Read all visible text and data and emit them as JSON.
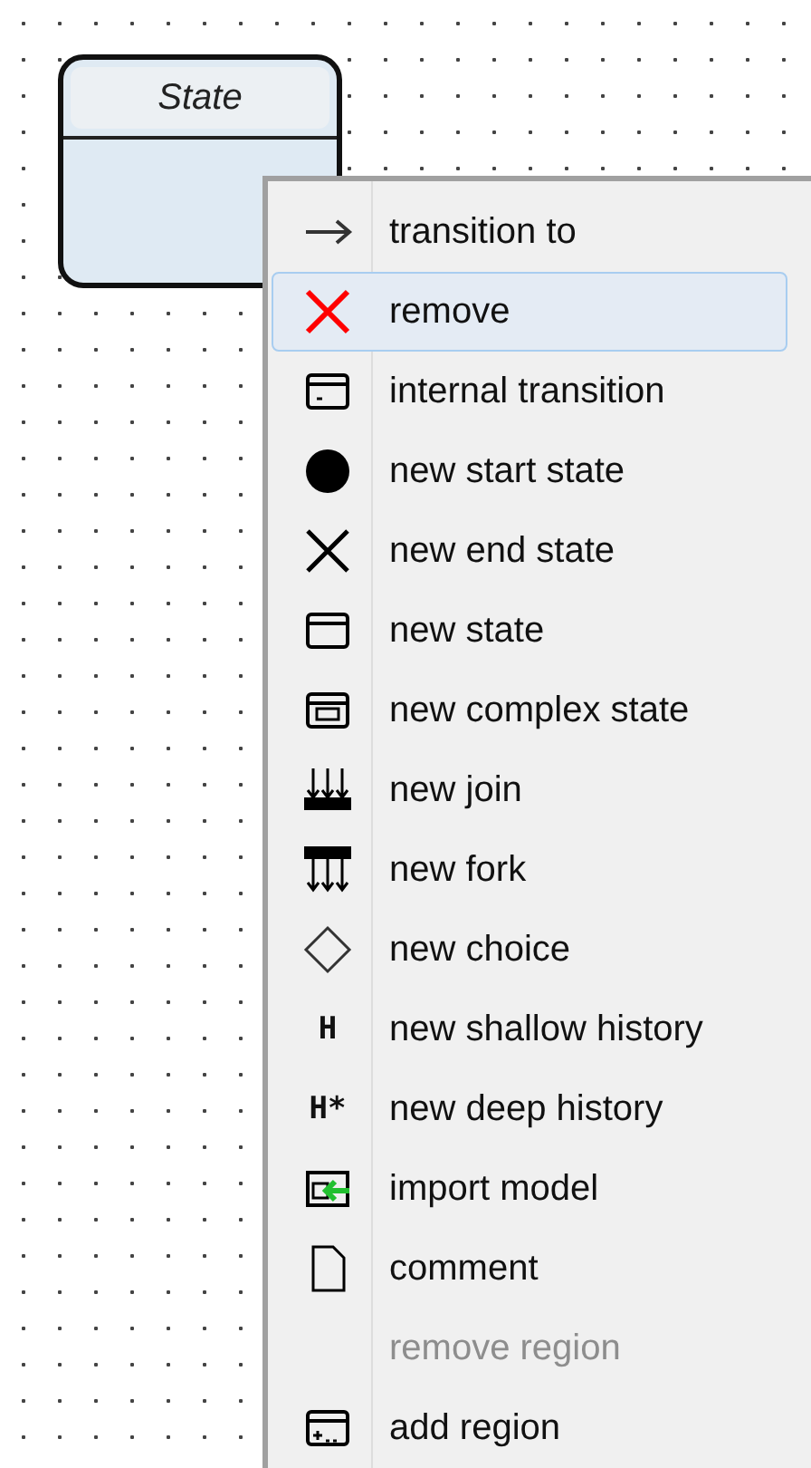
{
  "state_node": {
    "title": "State"
  },
  "context_menu": {
    "items": [
      {
        "kind": "arrow",
        "label": "transition to",
        "selected": false,
        "disabled": false
      },
      {
        "kind": "cross",
        "label": "remove",
        "selected": true,
        "disabled": false
      },
      {
        "kind": "internal",
        "label": "internal transition",
        "selected": false,
        "disabled": false
      },
      {
        "kind": "start",
        "label": "new start state",
        "selected": false,
        "disabled": false
      },
      {
        "kind": "end",
        "label": "new end state",
        "selected": false,
        "disabled": false
      },
      {
        "kind": "state",
        "label": "new state",
        "selected": false,
        "disabled": false
      },
      {
        "kind": "complex",
        "label": "new complex state",
        "selected": false,
        "disabled": false
      },
      {
        "kind": "join",
        "label": "new join",
        "selected": false,
        "disabled": false
      },
      {
        "kind": "fork",
        "label": "new fork",
        "selected": false,
        "disabled": false
      },
      {
        "kind": "choice",
        "label": "new choice",
        "selected": false,
        "disabled": false
      },
      {
        "kind": "glyph",
        "glyph": "H",
        "label": "new shallow history",
        "selected": false,
        "disabled": false
      },
      {
        "kind": "glyph",
        "glyph": "H*",
        "label": "new deep history",
        "selected": false,
        "disabled": false
      },
      {
        "kind": "import",
        "label": "import model",
        "selected": false,
        "disabled": false
      },
      {
        "kind": "comment",
        "label": "comment",
        "selected": false,
        "disabled": false
      },
      {
        "kind": "none",
        "label": "remove region",
        "selected": false,
        "disabled": true
      },
      {
        "kind": "region",
        "label": "add region",
        "selected": false,
        "disabled": false
      }
    ]
  }
}
